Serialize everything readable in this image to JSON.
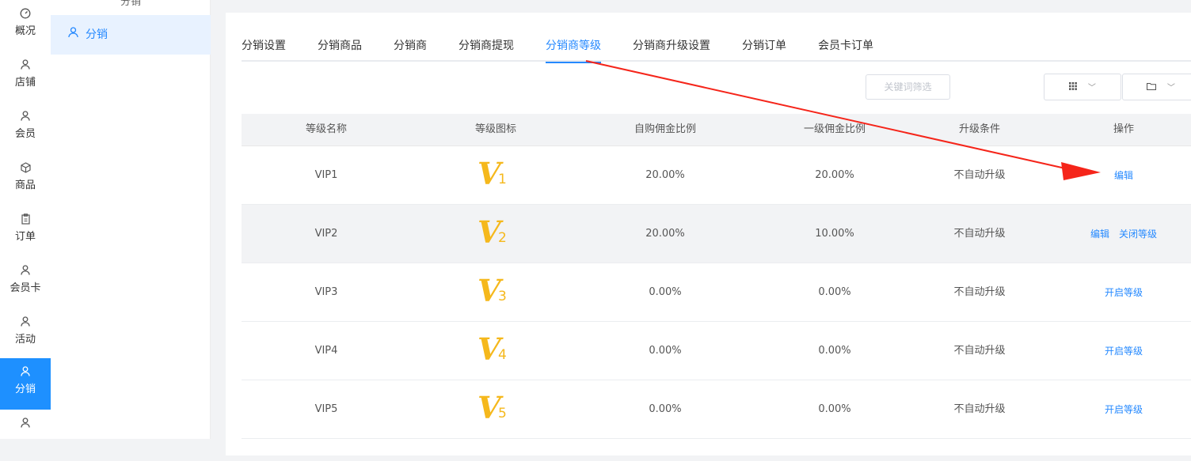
{
  "rail": [
    {
      "label": "概况",
      "icon": "dashboard-icon",
      "glyph": "◷",
      "active": false
    },
    {
      "label": "店铺",
      "icon": "user-icon",
      "glyph": "♙",
      "active": false
    },
    {
      "label": "会员",
      "icon": "user-icon",
      "glyph": "♙",
      "active": false
    },
    {
      "label": "商品",
      "icon": "box-icon",
      "glyph": "⬡",
      "active": false
    },
    {
      "label": "订单",
      "icon": "clipboard-icon",
      "glyph": "▤",
      "active": false
    },
    {
      "label": "会员卡",
      "icon": "user-icon",
      "glyph": "♙",
      "active": false
    },
    {
      "label": "活动",
      "icon": "user-icon",
      "glyph": "♙",
      "active": false
    },
    {
      "label": "分销",
      "icon": "user-icon",
      "glyph": "♙",
      "active": true
    },
    {
      "label": "",
      "icon": "user-icon",
      "glyph": "♙",
      "active": false
    }
  ],
  "subnav": {
    "top_label": "分销",
    "item": {
      "label": "分销",
      "icon": "user-icon"
    }
  },
  "tabs": [
    {
      "label": "分销设置",
      "active": false
    },
    {
      "label": "分销商品",
      "active": false
    },
    {
      "label": "分销商",
      "active": false
    },
    {
      "label": "分销商提现",
      "active": false
    },
    {
      "label": "分销商等级",
      "active": true
    },
    {
      "label": "分销商升级设置",
      "active": false
    },
    {
      "label": "分销订单",
      "active": false
    },
    {
      "label": "会员卡订单",
      "active": false
    }
  ],
  "toolbar": {
    "search_label": "关键词筛选",
    "grid_icon": "grid-icon",
    "folder_icon": "folder-icon"
  },
  "table": {
    "headers": [
      "等级名称",
      "等级图标",
      "自购佣金比例",
      "一级佣金比例",
      "升级条件",
      "操作"
    ],
    "rows": [
      {
        "name": "VIP1",
        "level_num": "1",
        "self_rate": "20.00%",
        "first_rate": "20.00%",
        "condition": "不自动升级",
        "actions": [
          "编辑"
        ]
      },
      {
        "name": "VIP2",
        "level_num": "2",
        "self_rate": "20.00%",
        "first_rate": "10.00%",
        "condition": "不自动升级",
        "actions": [
          "编辑",
          "关闭等级"
        ]
      },
      {
        "name": "VIP3",
        "level_num": "3",
        "self_rate": "0.00%",
        "first_rate": "0.00%",
        "condition": "不自动升级",
        "actions": [
          "开启等级"
        ]
      },
      {
        "name": "VIP4",
        "level_num": "4",
        "self_rate": "0.00%",
        "first_rate": "0.00%",
        "condition": "不自动升级",
        "actions": [
          "开启等级"
        ]
      },
      {
        "name": "VIP5",
        "level_num": "5",
        "self_rate": "0.00%",
        "first_rate": "0.00%",
        "condition": "不自动升级",
        "actions": [
          "开启等级"
        ]
      }
    ]
  },
  "logo_letter": "V",
  "colors": {
    "accent": "#2589ff",
    "arrow": "#f5251a",
    "badge": "#f5b81c"
  }
}
